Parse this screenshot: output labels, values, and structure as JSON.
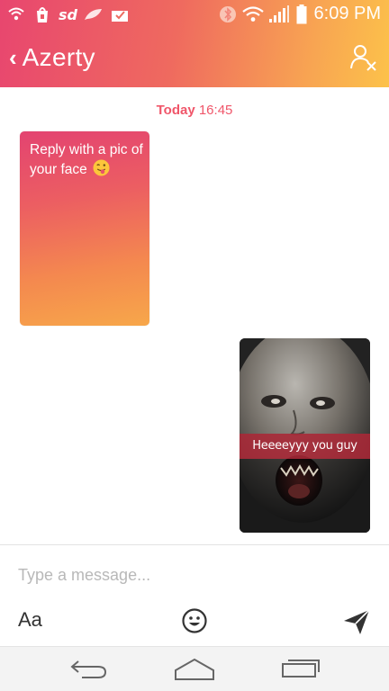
{
  "status_bar": {
    "time": "6:09 PM",
    "icons": [
      "wifi-notification-icon",
      "app-notification-icon",
      "sd-notification-icon",
      "feather-notification-icon",
      "mail-notification-icon",
      "bluetooth-icon",
      "wifi-signal-icon",
      "cell-signal-icon",
      "battery-icon"
    ]
  },
  "header": {
    "back_chevron": "‹",
    "contact_name": "Azerty",
    "unmatch_icon": "person-x-icon"
  },
  "conversation": {
    "date_day": "Today",
    "date_time": "16:45",
    "messages": [
      {
        "direction": "incoming",
        "text": "Reply with a pic of your face",
        "emoji": "tongue-wink-emoji"
      },
      {
        "direction": "outgoing",
        "type": "photo",
        "caption": "Heeeeyyy you guy"
      }
    ]
  },
  "composer": {
    "placeholder": "Type a message...",
    "font_label": "Aa",
    "emoji_icon": "smiley-icon",
    "send_icon": "send-icon"
  },
  "system_nav": {
    "buttons": [
      "back-icon",
      "home-icon",
      "recents-icon"
    ]
  },
  "colors": {
    "gradient_start": "#e8466f",
    "gradient_end": "#fcc24a",
    "accent": "#f0566a"
  }
}
